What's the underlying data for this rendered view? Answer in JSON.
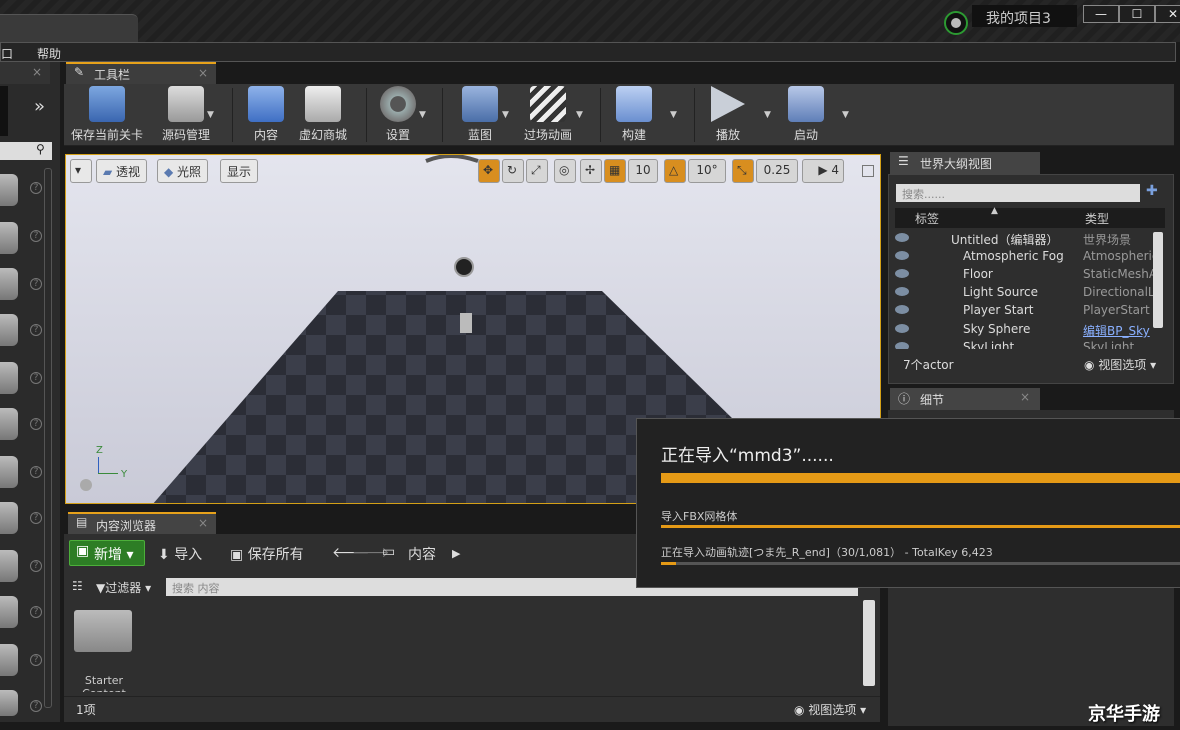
{
  "titlebar": {
    "project": "我的项目3",
    "minimize": "—",
    "maximize": "☐",
    "close": "✕"
  },
  "menubar": {
    "items": [
      "窗口",
      "帮助"
    ]
  },
  "toolbar_tab": {
    "label": "工具栏",
    "close": "×"
  },
  "toolbar": {
    "buttons": [
      {
        "label": "保存当前关卡",
        "icon": "save-icon"
      },
      {
        "label": "源码管理",
        "icon": "source-control-icon"
      },
      {
        "label": "内容",
        "icon": "content-icon"
      },
      {
        "label": "虚幻商城",
        "icon": "marketplace-icon"
      },
      {
        "label": "设置",
        "icon": "settings-icon"
      },
      {
        "label": "蓝图",
        "icon": "blueprint-icon"
      },
      {
        "label": "过场动画",
        "icon": "cinematics-icon"
      },
      {
        "label": "构建",
        "icon": "build-icon"
      },
      {
        "label": "播放",
        "icon": "play-icon"
      },
      {
        "label": "启动",
        "icon": "launch-icon"
      }
    ]
  },
  "viewport": {
    "perspective": "透视",
    "lit": "光照",
    "show": "显示",
    "grid_snap": "10",
    "rot_snap": "10°",
    "scale_snap": "0.25",
    "cam_speed": "4",
    "axis_z": "Z",
    "axis_y": "Y"
  },
  "outliner": {
    "tab": "世界大纲视图",
    "search_placeholder": "搜索......",
    "col_label": "标签",
    "col_type": "类型",
    "rows": [
      {
        "name": "Untitled（编辑器）",
        "type": "世界场景"
      },
      {
        "name": "Atmospheric Fog",
        "type": "Atmospheric"
      },
      {
        "name": "Floor",
        "type": "StaticMeshA"
      },
      {
        "name": "Light Source",
        "type": "DirectionalLi"
      },
      {
        "name": "Player Start",
        "type": "PlayerStart"
      },
      {
        "name": "Sky Sphere",
        "type": "编辑BP_Sky"
      },
      {
        "name": "SkyLight",
        "type": "SkyLight"
      }
    ],
    "count": "7个actor",
    "view_options": "视图选项"
  },
  "details": {
    "tab": "细节"
  },
  "import_dialog": {
    "title": "正在导入“mmd3”......",
    "line1": "导入FBX网格体",
    "line2": "正在导入动画轨迹[つま先_R_end]（30/1,081） - TotalKey 6,423",
    "progress_fraction": 0.028
  },
  "content_browser": {
    "tab": "内容浏览器",
    "new": "新增",
    "import": "导入",
    "save_all": "保存所有",
    "path": "内容",
    "filter": "过滤器",
    "search_placeholder": "搜索 内容",
    "folder": "Starter Content",
    "count": "1项",
    "view_options": "视图选项"
  },
  "watermark": "京华手游"
}
